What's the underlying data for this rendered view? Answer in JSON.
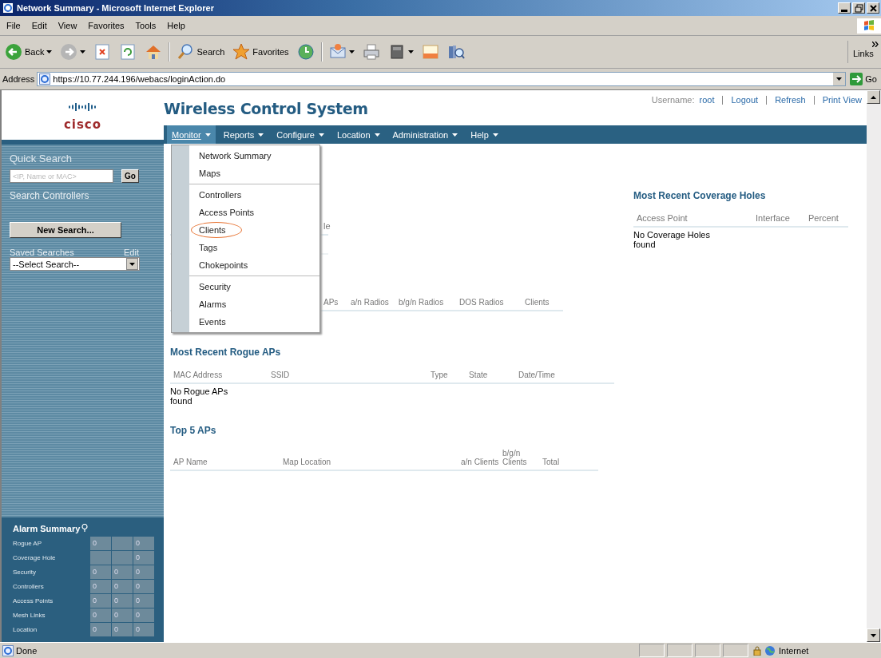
{
  "window": {
    "title": "Network Summary - Microsoft Internet Explorer"
  },
  "menu_bar": [
    "File",
    "Edit",
    "View",
    "Favorites",
    "Tools",
    "Help"
  ],
  "toolbar": {
    "buttons": [
      {
        "kind": "back",
        "label": "Back"
      },
      {
        "kind": "forward"
      },
      {
        "kind": "stop"
      },
      {
        "kind": "refresh"
      },
      {
        "kind": "home"
      },
      {
        "kind": "search",
        "label": "Search"
      },
      {
        "kind": "favorites",
        "label": "Favorites"
      },
      {
        "kind": "history"
      },
      {
        "kind": "mail"
      },
      {
        "kind": "print"
      },
      {
        "kind": "edit"
      },
      {
        "kind": "discuss"
      },
      {
        "kind": "research"
      }
    ],
    "links": "Links"
  },
  "address_bar": {
    "label": "Address",
    "url": "https://10.77.244.196/webacs/loginAction.do",
    "go": "Go"
  },
  "app": {
    "logo_text": "cisco",
    "title": "Wireless Control System",
    "user_label": "Username:",
    "user_name": "root",
    "header_links": [
      "Logout",
      "Refresh",
      "Print View"
    ]
  },
  "nav": [
    {
      "label": "Monitor",
      "selected": true
    },
    {
      "label": "Reports",
      "selected": false
    },
    {
      "label": "Configure",
      "selected": false
    },
    {
      "label": "Location",
      "selected": false
    },
    {
      "label": "Administration",
      "selected": false
    },
    {
      "label": "Help",
      "selected": false
    }
  ],
  "monitor_menu": {
    "groups": [
      {
        "items": [
          {
            "label": "Network Summary",
            "circled": false
          },
          {
            "label": "Maps",
            "circled": false
          }
        ]
      },
      {
        "items": [
          {
            "label": "Controllers",
            "circled": false
          },
          {
            "label": "Access Points",
            "circled": false
          },
          {
            "label": "Clients",
            "circled": true
          },
          {
            "label": "Tags",
            "circled": false
          },
          {
            "label": "Chokepoints",
            "circled": false
          }
        ]
      },
      {
        "items": [
          {
            "label": "Security",
            "circled": false
          },
          {
            "label": "Alarms",
            "circled": false
          },
          {
            "label": "Events",
            "circled": false
          }
        ]
      }
    ]
  },
  "sidebar": {
    "quick_search": {
      "title": "Quick Search",
      "placeholder": "<IP, Name or MAC>",
      "go": "Go"
    },
    "search_controllers": "Search Controllers",
    "new_search": "New Search...",
    "saved_searches": {
      "label": "Saved Searches",
      "edit": "Edit",
      "select": "--Select Search--"
    },
    "alarm_summary": {
      "title": "Alarm Summary",
      "rows": [
        {
          "name": "Rogue AP",
          "cells": [
            "0",
            null,
            "0"
          ]
        },
        {
          "name": "Coverage Hole",
          "cells": [
            null,
            null,
            "0"
          ]
        },
        {
          "name": "Security",
          "cells": [
            "0",
            "0",
            "0"
          ]
        },
        {
          "name": "Controllers",
          "cells": [
            "0",
            "0",
            "0"
          ]
        },
        {
          "name": "Access Points",
          "cells": [
            "0",
            "0",
            "0"
          ]
        },
        {
          "name": "Mesh Links",
          "cells": [
            "0",
            "0",
            "0"
          ]
        },
        {
          "name": "Location",
          "cells": [
            "0",
            "0",
            "0"
          ]
        }
      ]
    }
  },
  "hidden_table_1": {
    "columns": [
      "le"
    ]
  },
  "hidden_table_2": {
    "columns": [
      "APs",
      "a/n Radios",
      "b/g/n Radios",
      "DOS Radios",
      "Clients"
    ]
  },
  "rogue_aps": {
    "title": "Most Recent Rogue APs",
    "columns": [
      "MAC Address",
      "SSID",
      "Type",
      "State",
      "Date/Time"
    ],
    "empty": "No Rogue APs found"
  },
  "top_aps": {
    "title": "Top 5 APs",
    "columns": [
      "AP Name",
      "Map Location",
      "a/n Clients",
      "b/g/n Clients",
      "Total"
    ]
  },
  "coverage_holes": {
    "title": "Most Recent Coverage Holes",
    "columns": [
      "Access Point",
      "Interface",
      "Percent"
    ],
    "empty": "No Coverage Holes found"
  },
  "status_bar": {
    "text": "Done",
    "zone": "Internet"
  }
}
